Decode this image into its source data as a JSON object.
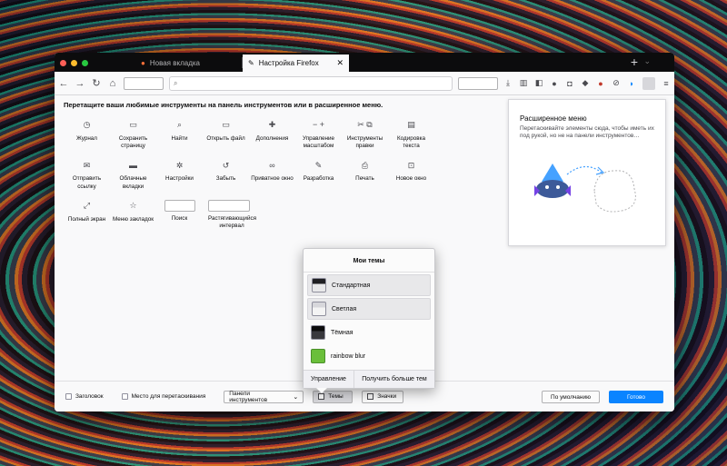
{
  "window": {
    "tabs": [
      {
        "title": "Новая вкладка",
        "active": false
      },
      {
        "title": "Настройка Firefox",
        "active": true
      }
    ]
  },
  "navbar": {
    "url": ""
  },
  "customize": {
    "instructions": "Перетащите ваши любимые инструменты на панель инструментов или в расширенное меню.",
    "palette": [
      {
        "label": "Журнал",
        "icon": "clock-icon"
      },
      {
        "label": "Сохранить страницу",
        "icon": "folder-icon"
      },
      {
        "label": "Найти",
        "icon": "search-icon"
      },
      {
        "label": "Открыть файл",
        "icon": "folder-open-icon"
      },
      {
        "label": "Дополнения",
        "icon": "puzzle-icon"
      },
      {
        "label": "Управление масштабом",
        "icon": "zoom-controls-icon"
      },
      {
        "label": "Инструменты правки",
        "icon": "edit-tools-icon"
      },
      {
        "label": "Кодировка текста",
        "icon": "text-encoding-icon"
      },
      {
        "label": "",
        "icon": ""
      },
      {
        "label": "Отправить ссылку",
        "icon": "email-icon"
      },
      {
        "label": "Облачные вкладки",
        "icon": "synced-tabs-icon"
      },
      {
        "label": "Настройки",
        "icon": "gear-icon"
      },
      {
        "label": "Забыть",
        "icon": "forget-icon"
      },
      {
        "label": "Приватное окно",
        "icon": "private-mask-icon"
      },
      {
        "label": "Разработка",
        "icon": "wrench-icon"
      },
      {
        "label": "Печать",
        "icon": "print-icon"
      },
      {
        "label": "Новое окно",
        "icon": "new-window-icon"
      },
      {
        "label": "",
        "icon": ""
      },
      {
        "label": "Полный экран",
        "icon": "fullscreen-icon"
      },
      {
        "label": "Меню закладок",
        "icon": "bookmarks-menu-icon"
      },
      {
        "label": "Поиск",
        "icon": "search-field"
      },
      {
        "label": "Растягивающийся интервал",
        "icon": "flexible-space"
      }
    ],
    "overflow": {
      "title": "Расширенное меню",
      "description": "Перетаскивайте элементы сюда, чтобы иметь их под рукой, но не на панели инструментов…"
    },
    "footer": {
      "title_bar": "Заголовок",
      "drag_space": "Место для перетаскивания",
      "toolbars": "Панели инструментов",
      "themes": "Темы",
      "density": "Значки",
      "restore_defaults": "По умолчанию",
      "done": "Готово"
    }
  },
  "themes_popup": {
    "title": "Мои темы",
    "items": [
      {
        "name": "Стандартная",
        "highlighted": true,
        "thumb_color": "#e8e8ea"
      },
      {
        "name": "Светлая",
        "highlighted": true,
        "thumb_color": "#f4f4f4"
      },
      {
        "name": "Тёмная",
        "highlighted": false,
        "thumb_color": "#1f1f23"
      },
      {
        "name": "rainbow blur",
        "highlighted": false,
        "thumb_color": "#6abf3a"
      }
    ],
    "manage": "Управление",
    "get_more": "Получить больше тем"
  },
  "colors": {
    "accent": "#0a84ff",
    "tabstrip": "#0c0c0d"
  }
}
